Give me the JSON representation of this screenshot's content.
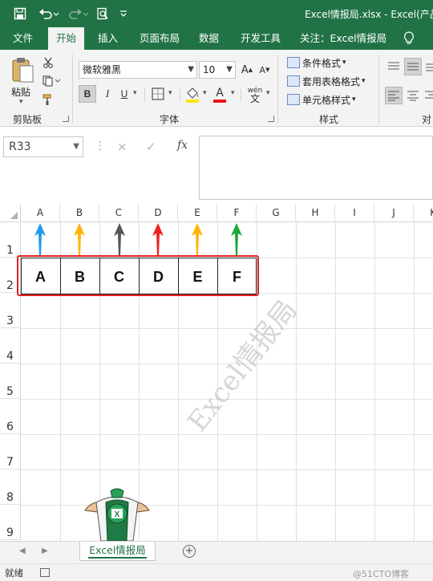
{
  "title_bar": {
    "title": "Excel情报局.xlsx  -  Excel(产品",
    "icons": [
      "save-icon",
      "undo-icon",
      "redo-icon",
      "print-preview-icon",
      "customize-qat-icon"
    ]
  },
  "tabs": [
    "文件",
    "开始",
    "插入",
    "页面布局",
    "数据",
    "开发工具",
    "关注：Excel情报局"
  ],
  "active_tab": "开始",
  "ribbon": {
    "clipboard": {
      "paste_label": "粘贴",
      "group_label": "剪贴板"
    },
    "font": {
      "font_name": "微软雅黑",
      "font_size": "10",
      "group_label": "字体",
      "bold": "B",
      "italic": "I",
      "underline": "U",
      "phonetic": "wén"
    },
    "styles": {
      "conditional_format": "条件格式",
      "table_format": "套用表格格式",
      "cell_styles": "单元格样式",
      "group_label": "样式"
    },
    "alignment": {
      "group_label": "对"
    }
  },
  "formula_bar": {
    "name_box": "R33",
    "cancel": "×",
    "enter": "✓",
    "fx": "fx",
    "value": ""
  },
  "grid": {
    "columns": [
      "A",
      "B",
      "C",
      "D",
      "E",
      "F",
      "G",
      "H",
      "I",
      "J",
      "K"
    ],
    "rows": [
      "1",
      "2",
      "3",
      "4",
      "5",
      "6",
      "7",
      "8",
      "9"
    ],
    "cells_row2": [
      "A",
      "B",
      "C",
      "D",
      "E",
      "F"
    ],
    "arrow_colors": [
      "#1e9bef",
      "#ffb400",
      "#555555",
      "#ef2222",
      "#ffb400",
      "#1fa83a"
    ],
    "frame_color": "#e02020",
    "watermark": "Excel情报局"
  },
  "sheet_tabs": {
    "active": "Excel情报局",
    "add": "+"
  },
  "status": {
    "ready": "就绪",
    "credit": "@51CTO博客"
  },
  "theme": {
    "accent": "#217346"
  }
}
